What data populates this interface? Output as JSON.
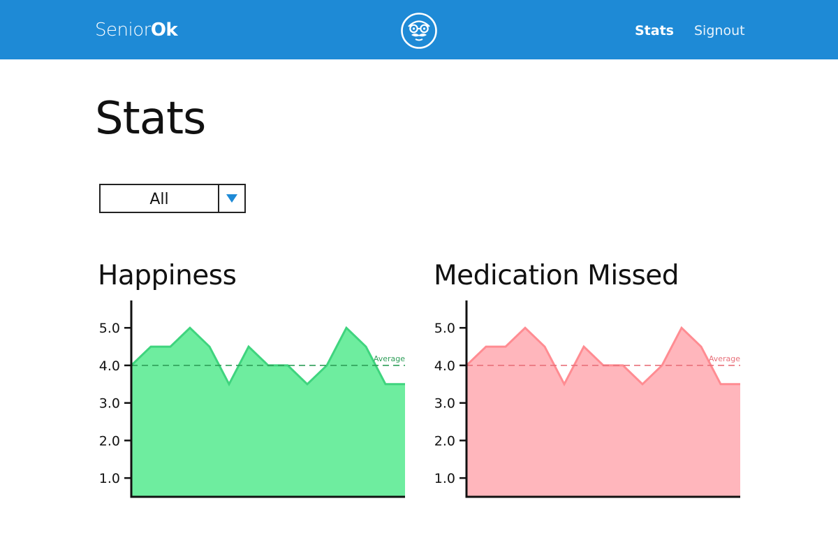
{
  "header": {
    "brand_light": "Senior",
    "brand_bold": "Ok",
    "logo_icon": "old-man-face-icon",
    "nav": {
      "stats": "Stats",
      "signout": "Signout"
    },
    "bg_color": "#1e8ad6"
  },
  "page": {
    "title": "Stats"
  },
  "filter": {
    "selected": "All",
    "caret_color": "#1e8ad6"
  },
  "chart_data": [
    {
      "type": "area",
      "title": "Happiness",
      "x": [
        0,
        1,
        2,
        3,
        4,
        5,
        6,
        7,
        8,
        9,
        10,
        11,
        12,
        13,
        14
      ],
      "values": [
        4.0,
        4.5,
        4.5,
        5.0,
        4.5,
        3.5,
        4.5,
        4.0,
        4.0,
        3.5,
        4.0,
        5.0,
        4.5,
        3.5,
        3.5
      ],
      "average": 4.0,
      "average_label": "Average",
      "yticks": [
        "1.0",
        "2.0",
        "3.0",
        "4.0",
        "5.0"
      ],
      "ylim": [
        0.5,
        5.45
      ],
      "xlabel": "",
      "ylabel": "",
      "grid": false,
      "fill_color": "#6eed9f",
      "line_color": "#3fd47e",
      "avg_color": "#2e9e58"
    },
    {
      "type": "area",
      "title": "Medication Missed",
      "x": [
        0,
        1,
        2,
        3,
        4,
        5,
        6,
        7,
        8,
        9,
        10,
        11,
        12,
        13,
        14
      ],
      "values": [
        4.0,
        4.5,
        4.5,
        5.0,
        4.5,
        3.5,
        4.5,
        4.0,
        4.0,
        3.5,
        4.0,
        5.0,
        4.5,
        3.5,
        3.5
      ],
      "average": 4.0,
      "average_label": "Average",
      "yticks": [
        "1.0",
        "2.0",
        "3.0",
        "4.0",
        "5.0"
      ],
      "ylim": [
        0.5,
        5.45
      ],
      "xlabel": "",
      "ylabel": "",
      "grid": false,
      "fill_color": "#ffb6bc",
      "line_color": "#ff8c92",
      "avg_color": "#e8707a"
    }
  ]
}
